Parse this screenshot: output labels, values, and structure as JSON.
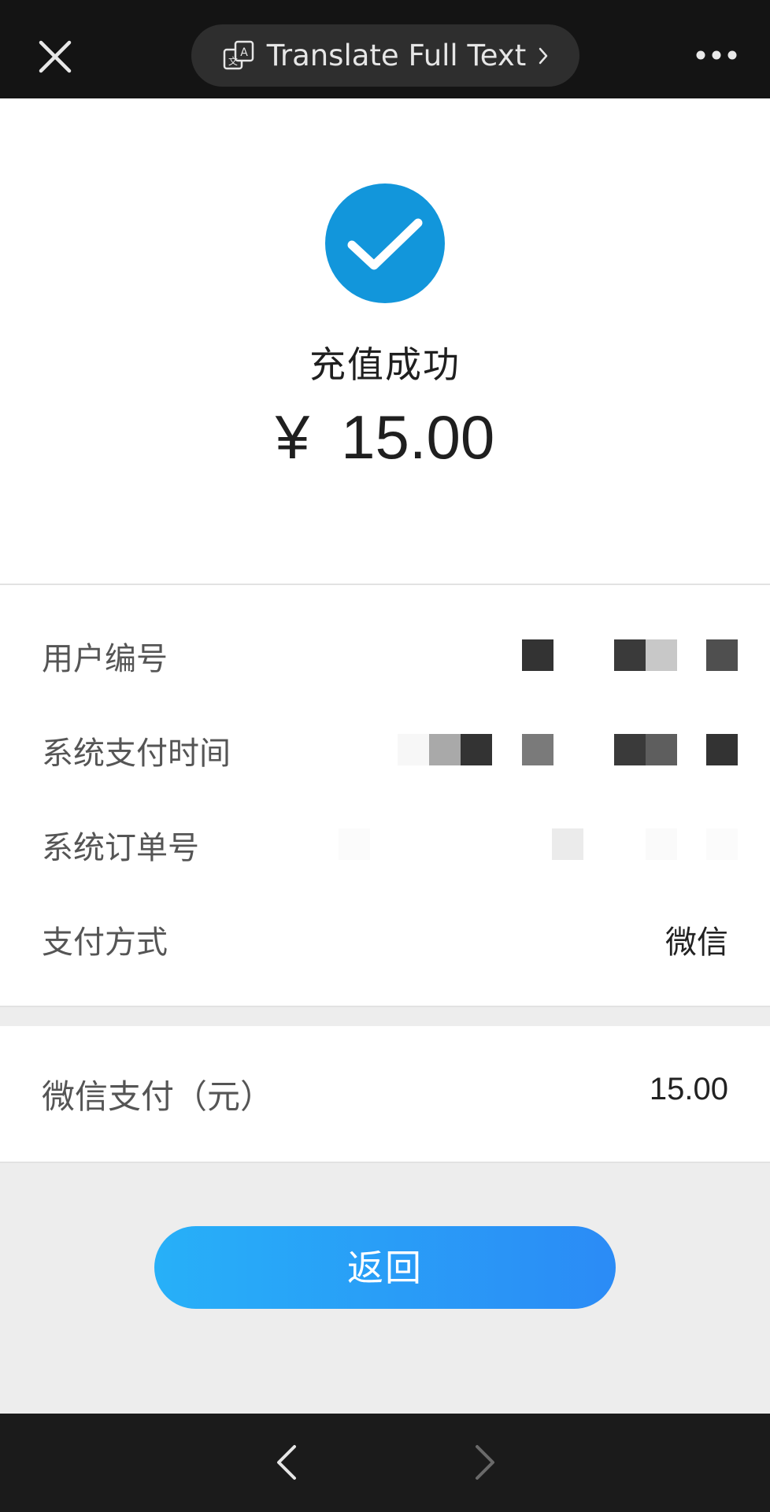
{
  "topbar": {
    "close_icon": "close-icon",
    "translate_label": "Translate Full Text",
    "translate_icon": "translate-icon",
    "more_icon": "more-dots-icon"
  },
  "result": {
    "status_icon": "check-circle-icon",
    "status_color": "#1296db",
    "title": "充值成功",
    "currency": "¥",
    "amount": "15.00"
  },
  "details": [
    {
      "label": "用户编号",
      "value": ""
    },
    {
      "label": "系统支付时间",
      "value": ""
    },
    {
      "label": "系统订单号",
      "value": ""
    },
    {
      "label": "支付方式",
      "value": "微信"
    }
  ],
  "payment": {
    "label": "微信支付（元）",
    "value": "15.00"
  },
  "actions": {
    "back_label": "返回",
    "gradient_start": "#27b0f8",
    "gradient_end": "#2b8bf6"
  },
  "bottombar": {
    "back_icon": "chevron-left-icon",
    "forward_icon": "chevron-right-icon"
  }
}
